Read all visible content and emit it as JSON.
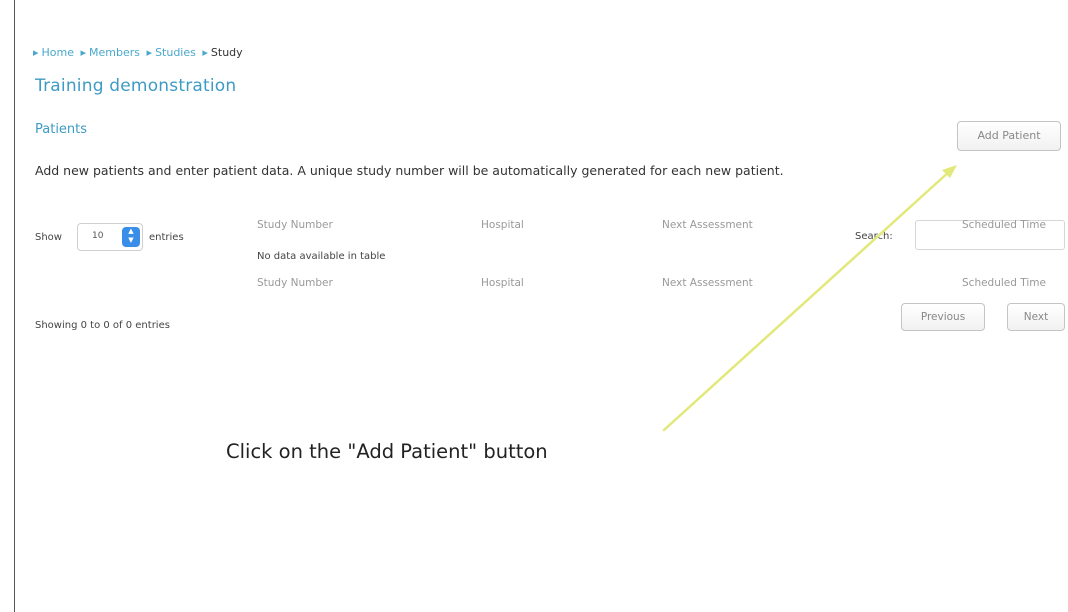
{
  "breadcrumb": {
    "items": [
      "Home",
      "Members",
      "Studies"
    ],
    "current": "Study",
    "separator": "▸"
  },
  "page_title": "Training demonstration",
  "section": {
    "title": "Patients",
    "description": "Add new patients and enter patient data. A unique study number will be automatically generated for each new patient.",
    "add_button_label": "Add Patient"
  },
  "table": {
    "length": {
      "show_label": "Show",
      "value": "10",
      "entries_label": "entries"
    },
    "search_label": "Search:",
    "columns": [
      "Study Number",
      "Hospital",
      "Next Assessment",
      "Scheduled Time"
    ],
    "empty_message": "No data available in table",
    "info": "Showing 0 to 0 of 0 entries",
    "pagination": {
      "previous": "Previous",
      "next": "Next"
    }
  },
  "annotation": {
    "instruction": "Click on the \"Add Patient\" button",
    "arrow_color": "#e2e87a"
  },
  "colors": {
    "link": "#4aa8cc",
    "title": "#3d9bc4",
    "stepper": "#3b8ee8"
  }
}
